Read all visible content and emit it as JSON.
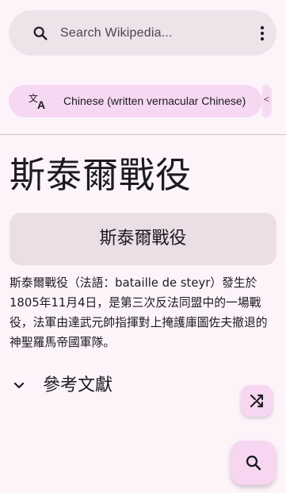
{
  "search": {
    "placeholder": "Search Wikipedia...",
    "icon": "search-icon",
    "menu_icon": "more-vert-icon"
  },
  "language_chip": {
    "label": "Chinese (written vernacular Chinese)",
    "icon": "translate-icon",
    "next_peek": "<"
  },
  "article": {
    "title": "斯泰爾戰役",
    "infobox_title": "斯泰爾戰役",
    "body": "斯泰爾戰役（法語：bataille de steyr）發生於1805年11月4日，是第三次反法同盟中的一場戰役，法軍由達武元帥指揮對上掩護庫圖佐夫撤退的神聖羅馬帝國軍隊。",
    "section": "參考文獻"
  },
  "fabs": {
    "random_icon": "shuffle-icon",
    "search_icon": "search-icon"
  },
  "colors": {
    "background": "#fdf4fa",
    "search_bar": "#efe3ea",
    "chip": "#f6d8f2",
    "infobox": "#ebdfe5",
    "fab": "#f7d6f1"
  }
}
